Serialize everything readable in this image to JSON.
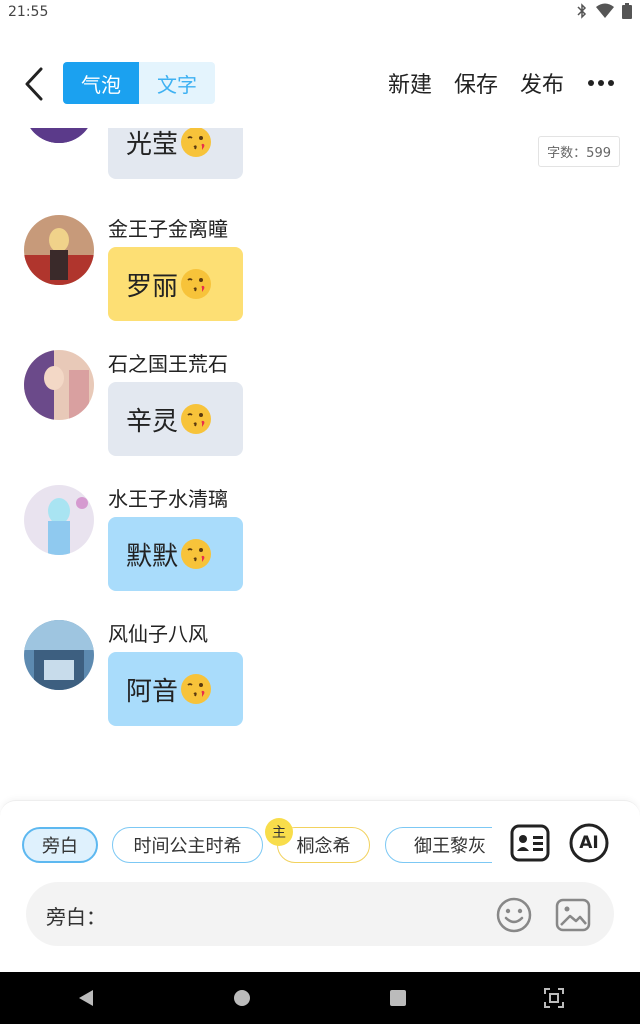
{
  "status_bar": {
    "time": "21:55",
    "icons": [
      "bluetooth-icon",
      "wifi-icon",
      "battery-icon"
    ]
  },
  "top_bar": {
    "segments": [
      {
        "label": "气泡",
        "active": true
      },
      {
        "label": "文字",
        "active": false
      }
    ],
    "actions": [
      "新建",
      "保存",
      "发布"
    ],
    "more_icon": "more-horizontal-icon",
    "back_icon": "back-chevron-icon"
  },
  "chat": {
    "word_count": "字数：599",
    "messages": [
      {
        "sender": "",
        "text": "光莹",
        "emoji": "kissing-face-emoji",
        "bubble_color": "#e3e8f0"
      },
      {
        "sender": "金王子金离瞳",
        "text": "罗丽",
        "emoji": "kissing-face-emoji",
        "bubble_color": "#fddf74"
      },
      {
        "sender": "石之国王荒石",
        "text": "辛灵",
        "emoji": "kissing-face-emoji",
        "bubble_color": "#e3e8f0"
      },
      {
        "sender": "水王子水清璃",
        "text": "默默",
        "emoji": "kissing-face-emoji",
        "bubble_color": "#a9dcfb"
      },
      {
        "sender": "风仙子八风",
        "text": "阿音",
        "emoji": "kissing-face-emoji",
        "bubble_color": "#a9dcfb"
      }
    ]
  },
  "composer": {
    "characters": [
      {
        "label": "旁白",
        "selected": true,
        "main": false
      },
      {
        "label": "时间公主时希",
        "selected": false,
        "main": false
      },
      {
        "label": "桐念希",
        "selected": false,
        "main": true
      },
      {
        "label": "御王黎灰",
        "selected": false,
        "main": false
      }
    ],
    "main_badge": "主",
    "tools": [
      "contact-card-icon",
      "ai-icon"
    ],
    "ai_label": "AI",
    "input_label": "旁白：",
    "input_icons": [
      "emoji-smile-icon",
      "image-icon"
    ]
  },
  "nav_bar": {
    "buttons": [
      "back-triangle-icon",
      "home-circle-icon",
      "recents-square-icon",
      "screenshot-icon"
    ]
  },
  "colors": {
    "accent": "#1ba1f0",
    "accent_light": "#e4f4fd",
    "main_badge": "#f8dd4b"
  }
}
